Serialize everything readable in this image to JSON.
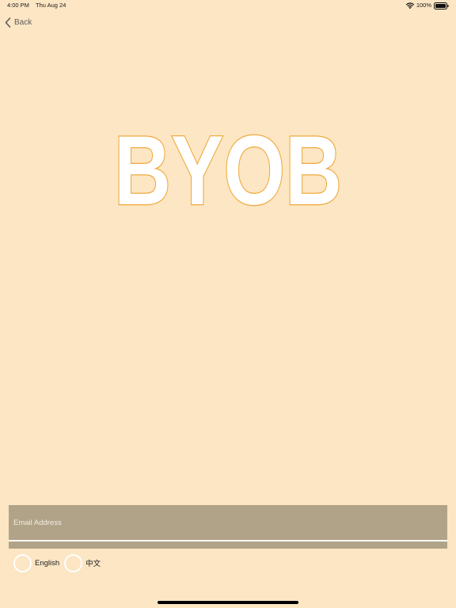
{
  "status_bar": {
    "time": "4:00 PM",
    "date": "Thu Aug 24",
    "battery": "100%",
    "icons": [
      "wifi-icon",
      "battery-icon"
    ]
  },
  "nav": {
    "back_label": "Back",
    "icon": "chevron-left-icon"
  },
  "logo": {
    "text": "BYOB"
  },
  "form": {
    "email_placeholder": "Email Address",
    "email_value": ""
  },
  "languages": {
    "options": [
      {
        "label": "English",
        "selected": false
      },
      {
        "label": "中文",
        "selected": false
      }
    ]
  },
  "colors": {
    "background": "#fce6c3",
    "logo_outline": "#eea83a",
    "logo_fill": "#ffffff",
    "input_background": "#b1a388"
  }
}
